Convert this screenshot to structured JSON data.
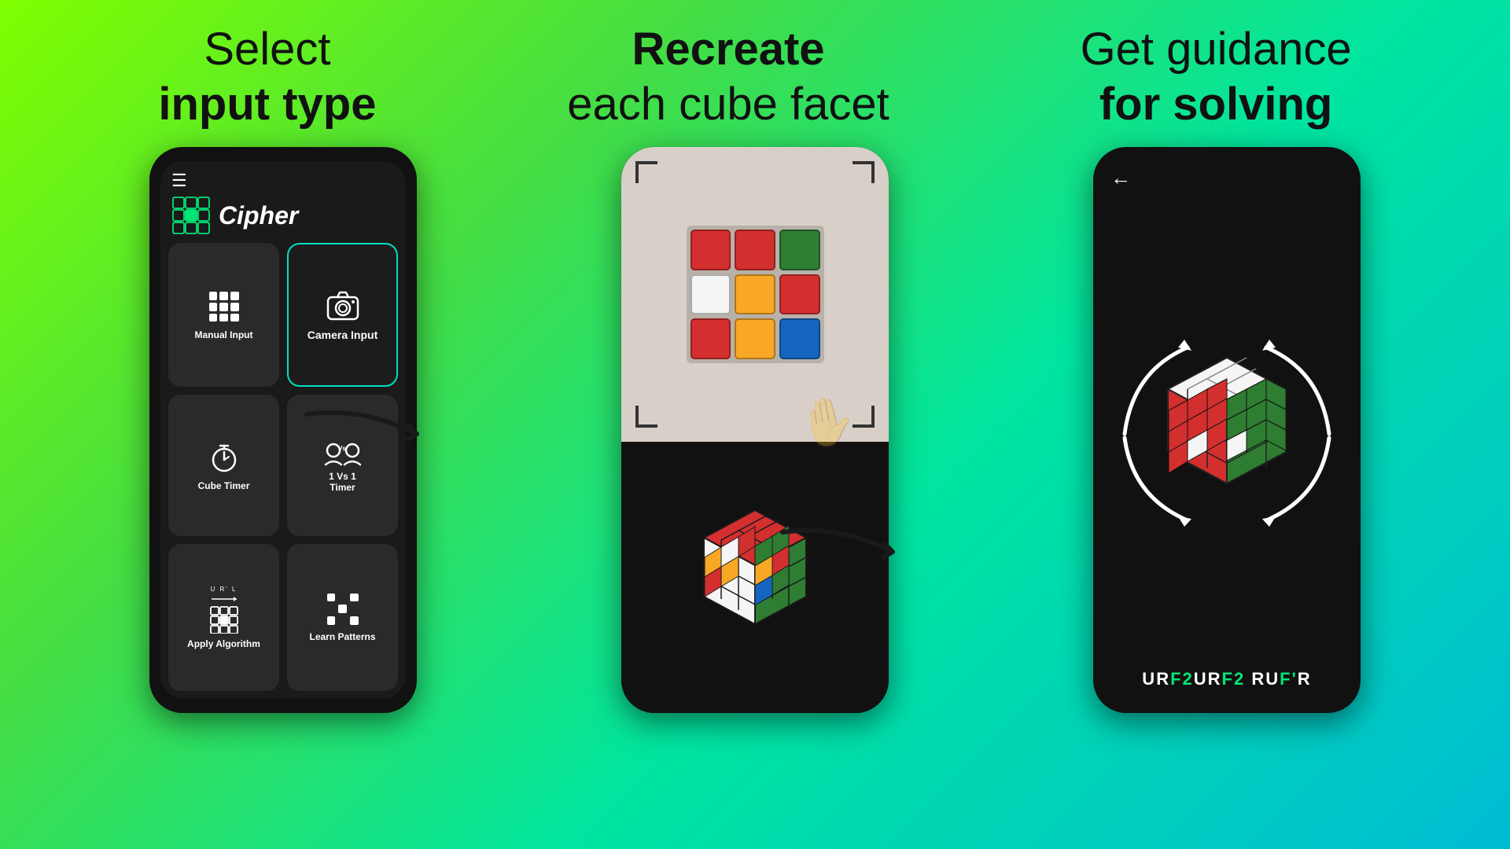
{
  "headers": {
    "col1_line1": "Select",
    "col1_line2": "input type",
    "col2_line1": "Recreate",
    "col2_line2": "each cube facet",
    "col3_line1": "Get guidance",
    "col3_line2": "for solving"
  },
  "phone1": {
    "app_name": "Cipher",
    "menu_items": [
      {
        "label": "Manual Input",
        "id": "manual-input"
      },
      {
        "label": "Camera Input",
        "id": "camera-input",
        "highlighted": true
      },
      {
        "label": "Cube Timer",
        "id": "cube-timer"
      },
      {
        "label": "1 Vs 1\nTimer",
        "id": "pvp-timer"
      },
      {
        "label": "Apply Algorithm",
        "id": "apply-algo"
      },
      {
        "label": "Learn Patterns",
        "id": "learn-patterns"
      }
    ]
  },
  "phone3": {
    "algo_sequence": "URF2URF2RUF'R"
  },
  "colors": {
    "background_start": "#7fff00",
    "background_end": "#00bcd4",
    "accent_green": "#00e676",
    "phone_bg": "#111111",
    "card_bg": "#2a2a2a",
    "highlight_border": "#00e0c0"
  }
}
